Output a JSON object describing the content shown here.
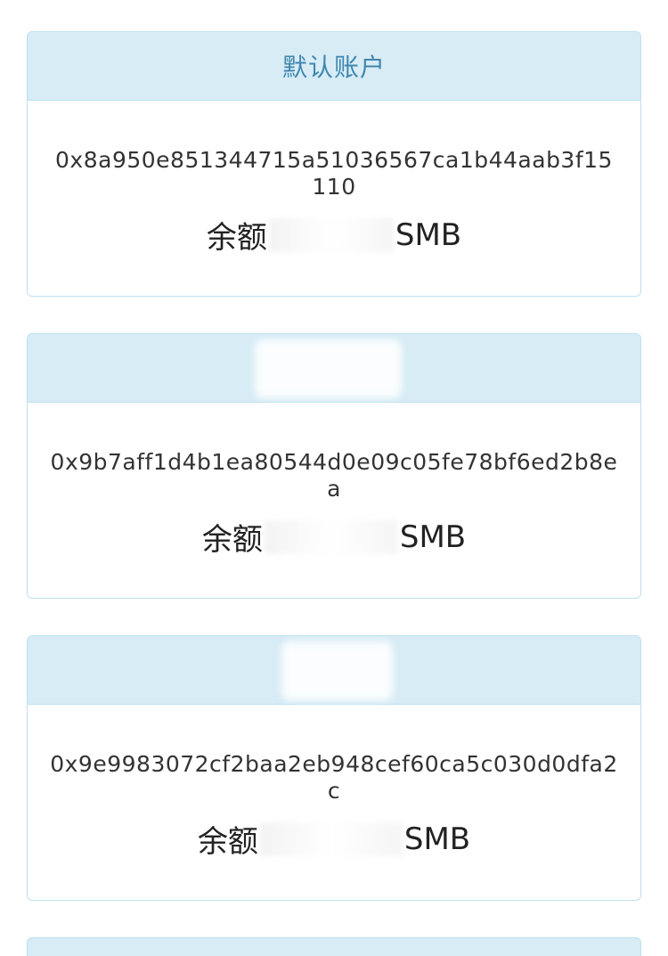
{
  "accounts": [
    {
      "title": "默认账户",
      "address": "0x8a950e851344715a51036567ca1b44aab3f15110",
      "balance_label": "余额",
      "unit": "SMB"
    },
    {
      "title": "",
      "address": "0x9b7aff1d4b1ea80544d0e09c05fe78bf6ed2b8ea",
      "balance_label": "余额",
      "unit": "SMB"
    },
    {
      "title": "",
      "address": "0x9e9983072cf2baa2eb948cef60ca5c030d0dfa2c",
      "balance_label": "余额",
      "unit": "SMB"
    }
  ],
  "colors": {
    "header_bg": "#d8ecf6",
    "border": "#bfe1ee",
    "title_text": "#3f86ad"
  }
}
